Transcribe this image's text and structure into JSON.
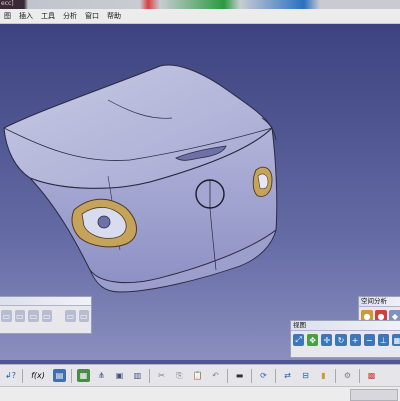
{
  "title_strip": {
    "text": "ecc]"
  },
  "menubar": {
    "items": [
      "图",
      "插入",
      "工具",
      "分析",
      "窗口",
      "帮助"
    ]
  },
  "toolbars": {
    "spatial_analysis": {
      "title": "空间分析"
    },
    "view": {
      "title": "视图"
    }
  },
  "bottom": {
    "formula_label": "f(x)"
  },
  "colors": {
    "accent": "#2a70c0",
    "background": "#4f5690"
  }
}
